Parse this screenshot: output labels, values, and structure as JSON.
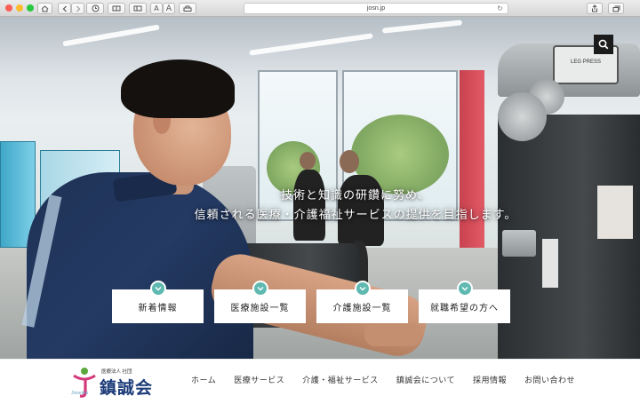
{
  "browser": {
    "url": "josn.jp",
    "text_small": "A",
    "text_large": "A"
  },
  "hero": {
    "tagline_line1": "技術と知識の研鑽に努め、",
    "tagline_line2": "信頼される医療・介護福祉サービスの提供を目指します。",
    "machine_label": "LEG PRESS"
  },
  "cards": [
    {
      "label": "新着情報"
    },
    {
      "label": "医療施設一覧"
    },
    {
      "label": "介護施設一覧"
    },
    {
      "label": "就職希望の方へ"
    }
  ],
  "logo": {
    "small_text": "医療法人 社団",
    "main_text": "鎮誠会",
    "roman_text": "Jinseikai"
  },
  "nav": [
    {
      "label": "ホーム"
    },
    {
      "label": "医療サービス"
    },
    {
      "label": "介護・福祉サービス"
    },
    {
      "label": "鎮誠会について"
    },
    {
      "label": "採用情報"
    },
    {
      "label": "お問い合わせ"
    }
  ],
  "colors": {
    "accent_teal": "#5fb9b1",
    "brand_navy": "#1c3b78",
    "logo_pink": "#d4387a"
  },
  "icons": {
    "search": "search-icon",
    "card_badge": "chevron-down-icon"
  }
}
